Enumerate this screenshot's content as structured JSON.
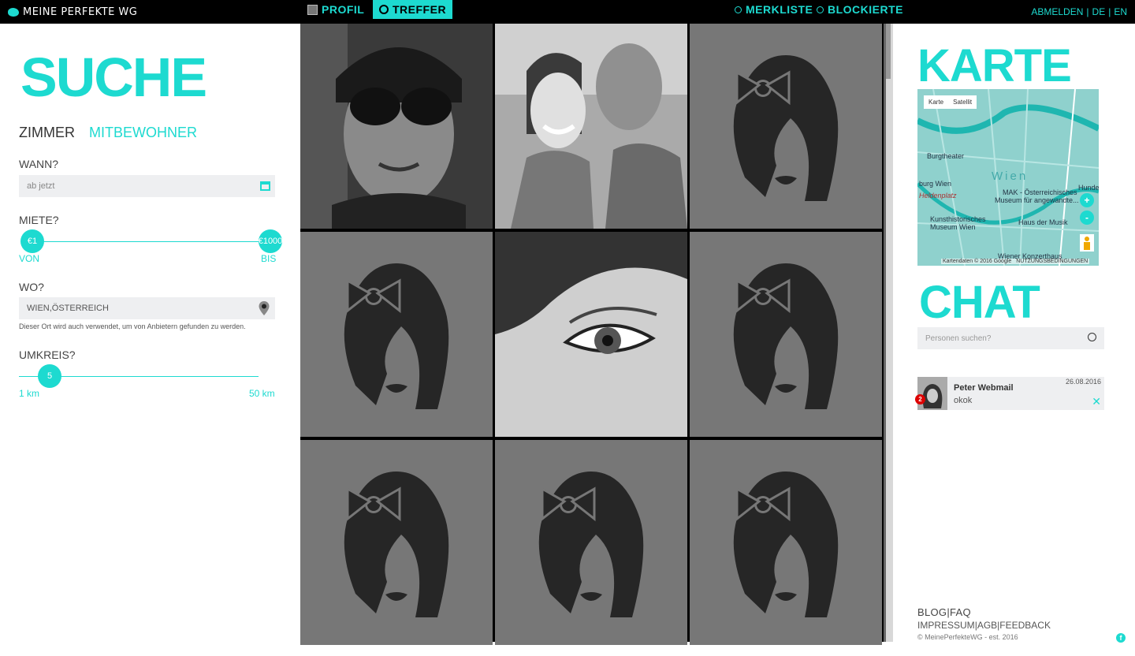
{
  "header": {
    "logo_text": "MEINE PERFEKTE WG",
    "nav": {
      "profil": "PROFIL",
      "treffer": "TREFFER",
      "merkliste": "MERKLISTE",
      "blockierte": "BLOCKIERTE"
    },
    "abmelden": "ABMELDEN",
    "sep1": "|",
    "lang_de": "DE",
    "sep2": "|",
    "lang_en": "EN"
  },
  "search": {
    "title": "SUCHE",
    "tab_zimmer": "ZIMMER",
    "tab_mitbewohner": "MITBEWOHNER",
    "wann_label": "WANN?",
    "wann_placeholder": "ab jetzt",
    "miete_label": "MIETE?",
    "miete_min": "€1",
    "miete_max": "€1000",
    "von": "VON",
    "bis": "BIS",
    "wo_label": "WO?",
    "wo_value": "WIEN,ÖSTERREICH",
    "wo_hint": "Dieser Ort wird auch verwendet, um von Anbietern gefunden zu werden.",
    "umkreis_label": "UMKREIS?",
    "umkreis_value": "5",
    "umkreis_min": "1 km",
    "umkreis_max": "50 km"
  },
  "map": {
    "title": "KARTE",
    "btn_karte": "Karte",
    "btn_satellit": "Satellit",
    "labels": [
      "Burgtheater",
      "Wien",
      "burg Wien",
      "Heldenplatz",
      "MAK - Österreichisches",
      "Museum für angewandte...",
      "Kunsthistorisches",
      "Museum Wien",
      "Haus der Musik",
      "Wiener Konzerthaus",
      "Hunder"
    ],
    "zoom_in": "+",
    "zoom_out": "-",
    "attribution": "Kartendaten © 2016 Google",
    "terms": "NUTZUNGSBEDINGUNGEN"
  },
  "chat": {
    "title": "CHAT",
    "search_placeholder": "Personen suchen?",
    "items": [
      {
        "name": "Peter Webmail",
        "message": "okok",
        "date": "26.08.2016",
        "unread": "2"
      }
    ]
  },
  "footer": {
    "blog": "BLOG",
    "faq": "FAQ",
    "impressum": "IMPRESSUM",
    "agb": "AGB",
    "feedback": "FEEDBACK",
    "copyright": "© MeinePerfekteWG - est. 2016",
    "fb": "f"
  },
  "colors": {
    "accent": "#1ddad0",
    "topbar": "#000000",
    "placeholder_bg": "#777777",
    "silhouette": "#262626"
  }
}
